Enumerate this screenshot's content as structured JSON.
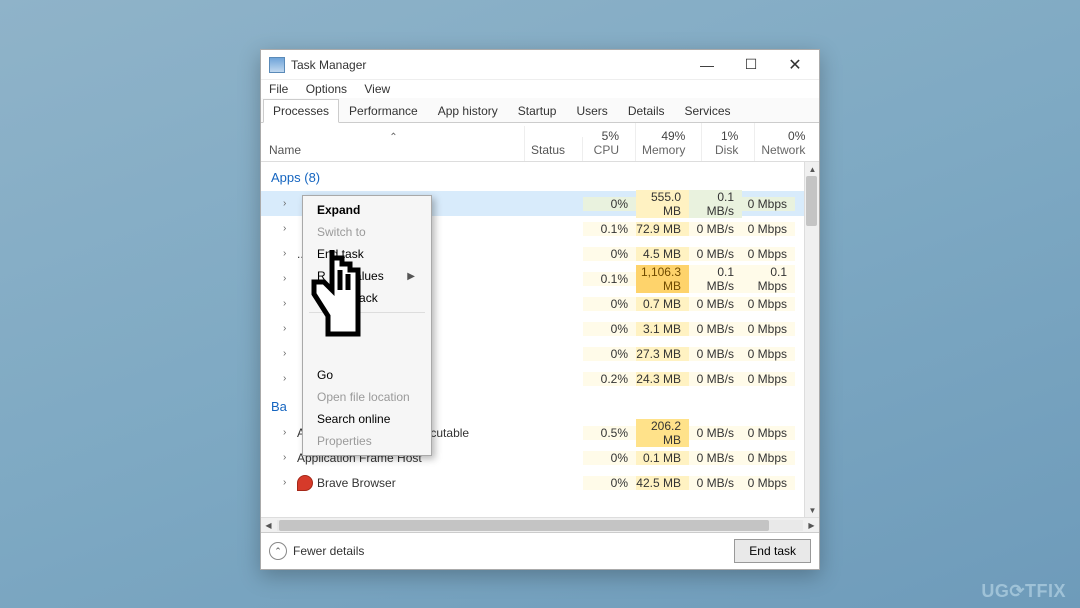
{
  "window": {
    "title": "Task Manager"
  },
  "menubar": [
    "File",
    "Options",
    "View"
  ],
  "tabs": [
    "Processes",
    "Performance",
    "App history",
    "Startup",
    "Users",
    "Details",
    "Services"
  ],
  "columns": {
    "name": "Name",
    "status": "Status",
    "metrics": [
      {
        "pct": "5%",
        "label": "CPU"
      },
      {
        "pct": "49%",
        "label": "Memory"
      },
      {
        "pct": "1%",
        "label": "Disk"
      },
      {
        "pct": "0%",
        "label": "Network"
      }
    ]
  },
  "groups": {
    "apps_label": "Apps (8)",
    "bg_label_fragment": "Ba"
  },
  "rows": [
    {
      "name": "",
      "cpu": "0%",
      "mem": "555.0 MB",
      "disk": "0.1 MB/s",
      "net": "0 Mbps",
      "selected": true
    },
    {
      "name": "",
      "cpu": "0.1%",
      "mem": "72.9 MB",
      "disk": "0 MB/s",
      "net": "0 Mbps"
    },
    {
      "name": "...",
      "cpu": "0%",
      "mem": "4.5 MB",
      "disk": "0 MB/s",
      "net": "0 Mbps"
    },
    {
      "name": "",
      "cpu": "0.1%",
      "mem": "1,106.3 MB",
      "disk": "0.1 MB/s",
      "net": "0.1 Mbps",
      "hot": "vhot"
    },
    {
      "name": "",
      "cpu": "0%",
      "mem": "0.7 MB",
      "disk": "0 MB/s",
      "net": "0 Mbps"
    },
    {
      "name": "",
      "cpu": "0%",
      "mem": "3.1 MB",
      "disk": "0 MB/s",
      "net": "0 Mbps"
    },
    {
      "name": "",
      "cpu": "0%",
      "mem": "27.3 MB",
      "disk": "0 MB/s",
      "net": "0 Mbps"
    },
    {
      "name": "",
      "cpu": "0.2%",
      "mem": "24.3 MB",
      "disk": "0 MB/s",
      "net": "0 Mbps"
    }
  ],
  "bg_rows": [
    {
      "name": "Antimalware Service Executable",
      "cpu": "0.5%",
      "mem": "206.2 MB",
      "disk": "0 MB/s",
      "net": "0 Mbps",
      "hot": "hot"
    },
    {
      "name": "Application Frame Host",
      "cpu": "0%",
      "mem": "0.1 MB",
      "disk": "0 MB/s",
      "net": "0 Mbps"
    },
    {
      "name": "Brave Browser",
      "cpu": "0%",
      "mem": "42.5 MB",
      "disk": "0 MB/s",
      "net": "0 Mbps"
    }
  ],
  "context_menu": [
    {
      "label": "Expand",
      "bold": true
    },
    {
      "label": "Switch to",
      "dim": true
    },
    {
      "label": "End task"
    },
    {
      "label": "Resource values",
      "submenu": true,
      "partial_suffix": "rce values"
    },
    {
      "label": "Provide feedback",
      "partial_suffix": "eedback"
    },
    {
      "sep": true
    },
    {
      "label": "Go",
      "partial": "Go"
    },
    {
      "label": "Open file location",
      "dim": true
    },
    {
      "label": "Search online"
    },
    {
      "label": "Properties",
      "dim": true
    }
  ],
  "footer": {
    "fewer": "Fewer details",
    "end": "End task"
  },
  "watermark": "UG⟳TFIX"
}
